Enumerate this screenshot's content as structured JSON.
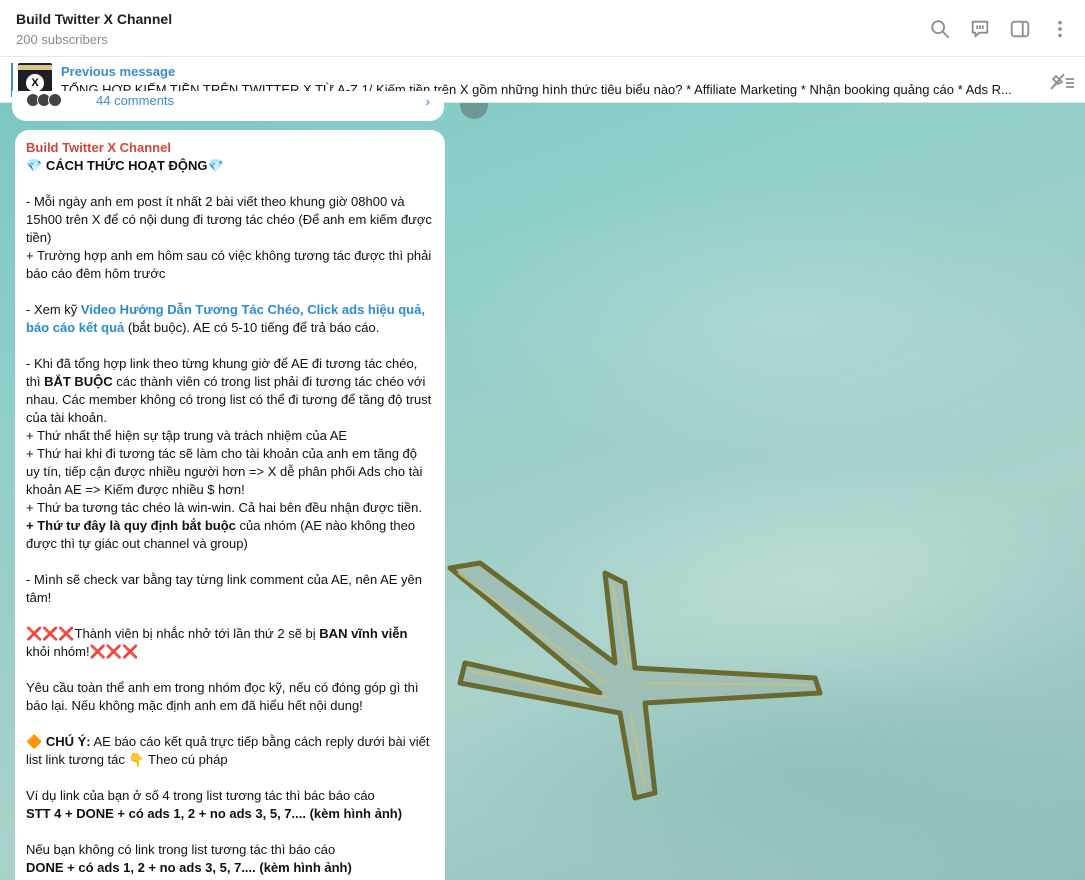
{
  "header": {
    "title": "Build Twitter X Channel",
    "subtitle": "200 subscribers",
    "icons": [
      "search-icon",
      "discussion-icon",
      "sidebar-icon",
      "more-icon"
    ]
  },
  "pinned": {
    "label": "Previous message",
    "text": "TỔNG HỢP KIẾM TIỀN TRÊN TWITTER X TỪ A-Z  1/ Kiếm tiền trên X gồm những hình thức tiêu biểu nào? * Affiliate Marketing * Nhận booking quảng cáo * Ads R...",
    "thumb_text": "X"
  },
  "prev_message": {
    "comments": "44 comments"
  },
  "message": {
    "sender": "Build Twitter X Channel",
    "heading": "CÁCH THỨC HOẠT ĐỘNG",
    "p1": "- Mỗi ngày anh em post ít nhất 2 bài viết theo khung giờ 08h00 và 15h00 trên X để có nội dung đi tương tác chéo (Để anh em kiếm được tiền)",
    "p2": "+ Trường hợp anh em hôm sau có việc không tương tác được thì phải báo cáo đêm hôm trước",
    "p3_pre": "- Xem kỹ ",
    "p3_link": "Video Hướng Dẫn Tương Tác Chéo, Click ads hiệu quả, báo cáo kết quả",
    "p3_post": " (bắt buộc). AE có 5-10 tiếng để trả báo cáo.",
    "p4_pre": "- Khi đã tổng hợp link theo từng khung giờ để AE đi tương tác chéo, thì ",
    "p4_bold": "BẮT BUỘC",
    "p4_post": " các thành viên có trong list phải đi tương tác chéo với nhau. Các member không có trong list có thể đi tương để tăng độ trust của tài khoản.",
    "p5": "+ Thứ nhất thể hiện sự tập trung và trách nhiệm của AE",
    "p6": "+ Thứ hai khi đi tương tác sẽ làm cho tài khoản của anh em tăng độ uy tín, tiếp cận được nhiều người hơn => X dễ phân phối Ads cho tài khoản AE => Kiếm được nhiều $ hơn!",
    "p7": "+ Thứ ba tương tác chéo là win-win. Cả hai bên đều nhận được tiền.",
    "p8_bold": "+ Thứ tư đây là quy định bắt buộc",
    "p8_post": " của nhóm (AE nào không theo được thì tự giác out channel và group)",
    "p9": "- Mình sẽ check var bằng tay từng link comment của AE, nên AE yên tâm!",
    "p10_pre": "Thành viên bị nhắc nhở tới lần thứ 2 sẽ bị ",
    "p10_bold": "BAN vĩnh viễn",
    "p10_post": " khỏi nhóm!",
    "p11": "Yêu cầu toàn thể anh em trong nhóm đọc kỹ, nếu có đóng góp gì thì báo lại. Nếu không mặc định anh em đã hiểu hết nội dung!",
    "p12_bold": "CHÚ Ý:",
    "p12_post": " AE báo cáo kết quả trực tiếp bằng cách reply dưới bài viết list link tương tác ",
    "p12_end": " Theo cú pháp",
    "p13": "Ví dụ link của bạn ở số 4 trong list tương tác thì bác báo cáo",
    "p14": "STT 4 + DONE + có ads 1, 2 + no ads 3, 5, 7.... (kèm hình ảnh)",
    "p15": "Nếu bạn không có link trong list tương tác thì báo cáo",
    "p16": "DONE + có ads 1, 2 + no ads 3, 5, 7.... (kèm hình ảnh)"
  },
  "colors": {
    "link": "#2a8bd0",
    "sender": "#d0473c",
    "accent": "#3a8bd1"
  }
}
